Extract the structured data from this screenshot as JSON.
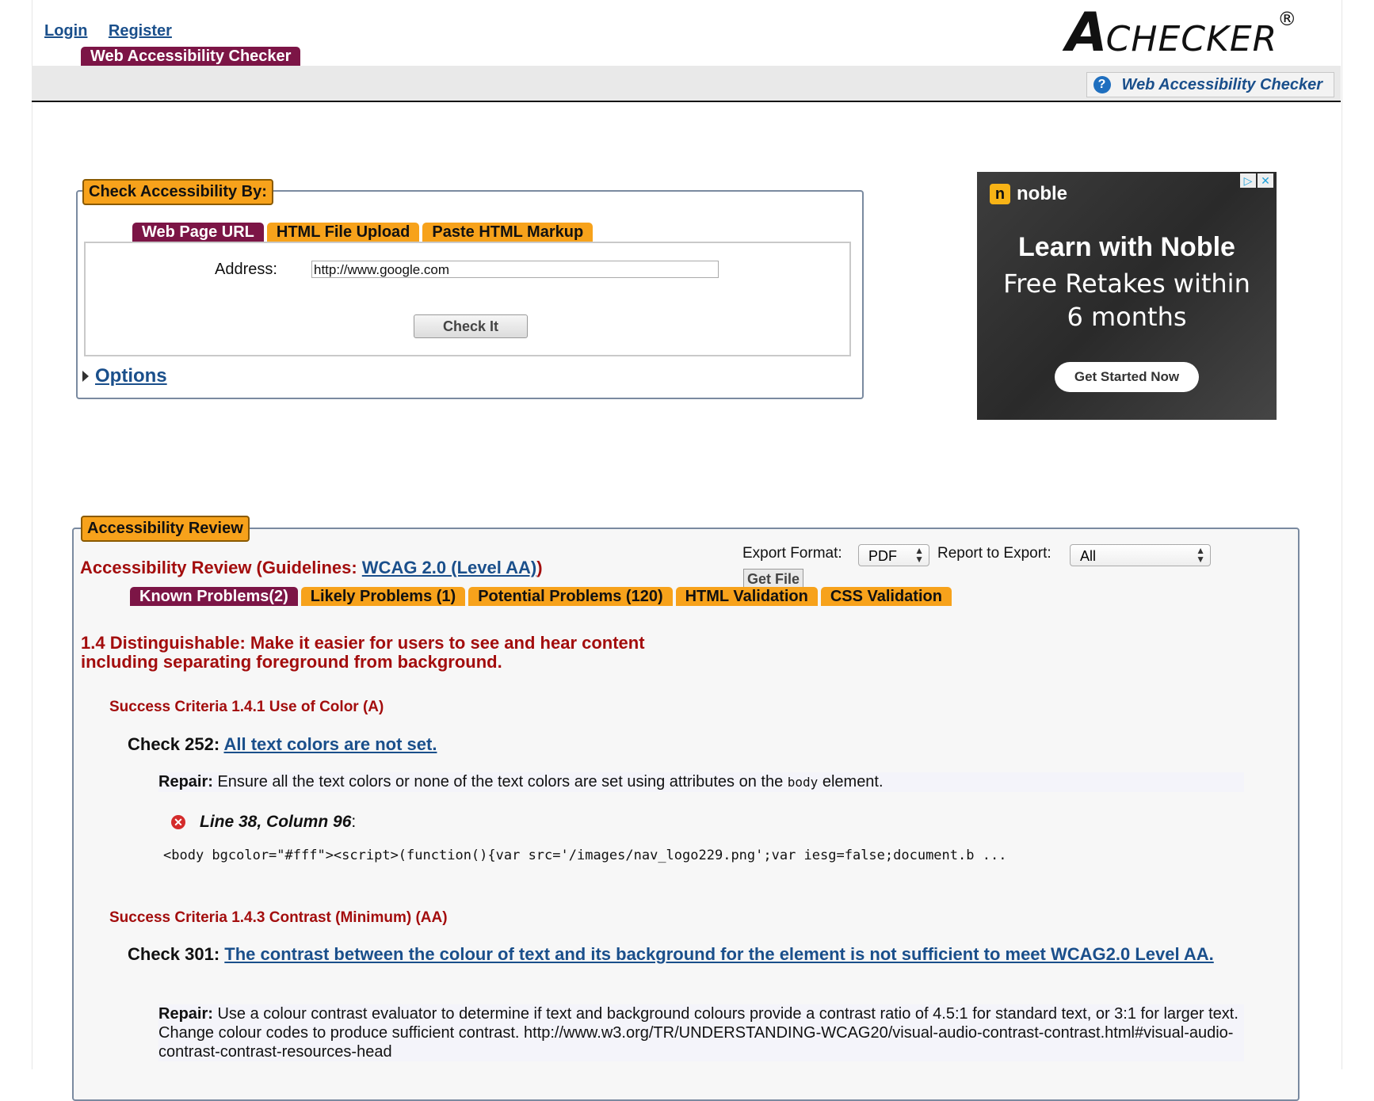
{
  "top_links": {
    "login": "Login",
    "register": "Register"
  },
  "logo": {
    "a": "A",
    "rest": "CHECKER",
    "reg": "®"
  },
  "header_tab": "Web Accessibility Checker",
  "help_link": {
    "icon": "help-icon",
    "text": "Web Accessibility Checker"
  },
  "check_box": {
    "legend": "Check Accessibility By:",
    "tabs": [
      "Web Page URL",
      "HTML File Upload",
      "Paste HTML Markup"
    ],
    "active_tab": 0,
    "address_label": "Address:",
    "address_value": "http://www.google.com",
    "check_button": "Check It",
    "options_link": "Options"
  },
  "ad": {
    "brand": "noble",
    "brand_icon": "n",
    "headline": "Learn with Noble",
    "subline_1": "Free Retakes within",
    "subline_2": "6 months",
    "cta": "Get Started Now",
    "choice_icons": [
      "adchoices-icon",
      "close-icon"
    ]
  },
  "review": {
    "legend": "Accessibility Review",
    "title_prefix": "Accessibility Review (Guidelines: ",
    "guideline_link": "WCAG 2.0 (Level AA)",
    "title_suffix": ")",
    "export_label": "Export Format:",
    "export_value": "PDF",
    "report_label": "Report to Export:",
    "report_value": "All",
    "get_file": "Get File",
    "tabs": [
      "Known Problems(2)",
      "Likely Problems (1)",
      "Potential Problems (120)",
      "HTML Validation",
      "CSS Validation"
    ],
    "active_tab": 0,
    "guideline_heading_1": "1.4 Distinguishable: Make it easier for users to see and hear content",
    "guideline_heading_2": "including separating foreground from background.",
    "criteria": [
      {
        "title": "Success Criteria 1.4.1 Use of Color (A)",
        "check_label": "Check 252: ",
        "check_link": "All text colors are not set.",
        "repair_label": "Repair:",
        "repair_text_1": " Ensure all the text colors or none of the text colors are set using attributes on the ",
        "repair_code": "body",
        "repair_text_2": " element.",
        "line_info": "Line 38, Column 96",
        "line_suffix": ":",
        "code": "<body bgcolor=\"#fff\"><script>(function(){var src='/images/nav_logo229.png';var iesg=false;document.b ..."
      },
      {
        "title": "Success Criteria 1.4.3 Contrast (Minimum) (AA)",
        "check_label": "Check 301: ",
        "check_link": "The contrast between the colour of text and its background for the element is not sufficient to meet WCAG2.0 Level AA.",
        "repair_label": "Repair:",
        "repair_text": " Use a colour contrast evaluator to determine if text and background colours provide a contrast ratio of 4.5:1 for standard text, or 3:1 for larger text. Change colour codes to produce sufficient contrast. http://www.w3.org/TR/UNDERSTANDING-WCAG20/visual-audio-contrast-contrast.html#visual-audio-contrast-contrast-resources-head"
      }
    ]
  },
  "colors": {
    "purple": "#7c1546",
    "orange": "#f7a21b",
    "link": "#1a4f8b",
    "heading_red": "#a30d0d"
  }
}
